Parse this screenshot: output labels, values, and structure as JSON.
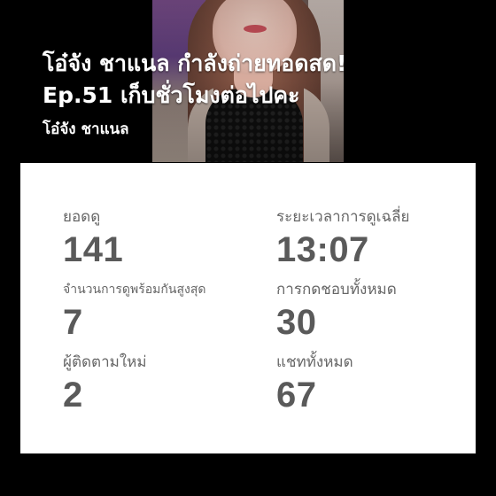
{
  "stream": {
    "title_line1": "โอ๋จัง ชาแนล กำลังถ่ายทอดสด!",
    "title_line2": "Ep.51 เก็บชั่วโมงต่อไปคะ",
    "channel_name": "โอ๋จัง ชาแนล"
  },
  "stats": {
    "views": {
      "label": "ยอดดู",
      "value": "141"
    },
    "avg_watch_time": {
      "label": "ระยะเวลาการดูเฉลี่ย",
      "value": "13:07"
    },
    "peak_concurrent": {
      "label": "จำนวนการดูพร้อมกันสูงสุด",
      "value": "7"
    },
    "total_likes": {
      "label": "การกดชอบทั้งหมด",
      "value": "30"
    },
    "new_followers": {
      "label": "ผู้ติดตามใหม่",
      "value": "2"
    },
    "total_chats": {
      "label": "แชททั้งหมด",
      "value": "67"
    }
  },
  "colors": {
    "background": "#000000",
    "card": "#ffffff",
    "label": "#666666",
    "value": "#5a5a5a",
    "title": "#ffffff"
  }
}
